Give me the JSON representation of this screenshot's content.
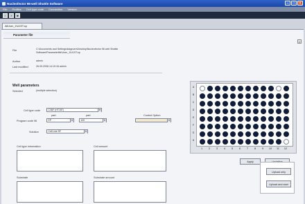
{
  "window": {
    "title": "Nucleofector 96-well Shuttle Software"
  },
  "menu": [
    "File",
    "Profiles",
    "Cell type code",
    "Connection",
    "Version"
  ],
  "tab": {
    "label": "AllUser_1\\U1ST.sp"
  },
  "panel_title": "Parameter file",
  "file_info": {
    "file_label": "File",
    "file_value": "C:\\Documents and Settings\\lukgruen\\Desktop\\Nucleofector 96 well Shuttle Software\\Parameterfile\\User_1\\U1ST.sp",
    "author_label": "Author",
    "author_value": "admin",
    "modified_label": "Last modified",
    "modified_value": "26.09.2008 14:10:16 admin"
  },
  "well_parameters": {
    "title": "Well parameters",
    "selected_label": "Selected",
    "selected_value": "(multiple selection)",
    "cell_type_label": "Cell type code",
    "cell_type_value": "C3DF (HT15T)",
    "part_label": "part",
    "part2_label": "part",
    "control_option_label": "Control Option",
    "program_label": "Program code 96",
    "program_value1": "EP",
    "program_value2": "100",
    "control_option_value": "",
    "solution_label": "Solution",
    "solution_value": "Cell Line SF"
  },
  "boxes": {
    "cell_type_info": "Cell type information",
    "cell_amount": "Cell amount",
    "substrate": "Substrate",
    "substrate_amount": "Substrate amount"
  },
  "plate": {
    "rows": [
      "A",
      "B",
      "C",
      "D",
      "E",
      "F",
      "G",
      "H"
    ],
    "cols": [
      "1",
      "2",
      "3",
      "4",
      "5",
      "6",
      "7",
      "8",
      "9",
      "10",
      "11",
      "12"
    ],
    "empty_wells": [
      "A1",
      "A11",
      "H12"
    ]
  },
  "buttons": {
    "apply": "Apply",
    "undefine": "Undefine",
    "upload_only": "Upload only",
    "upload_and_start": "Upload and start"
  },
  "colors": {
    "titlebar": "#2f62c8",
    "well_filled": "#0f1c3a"
  }
}
